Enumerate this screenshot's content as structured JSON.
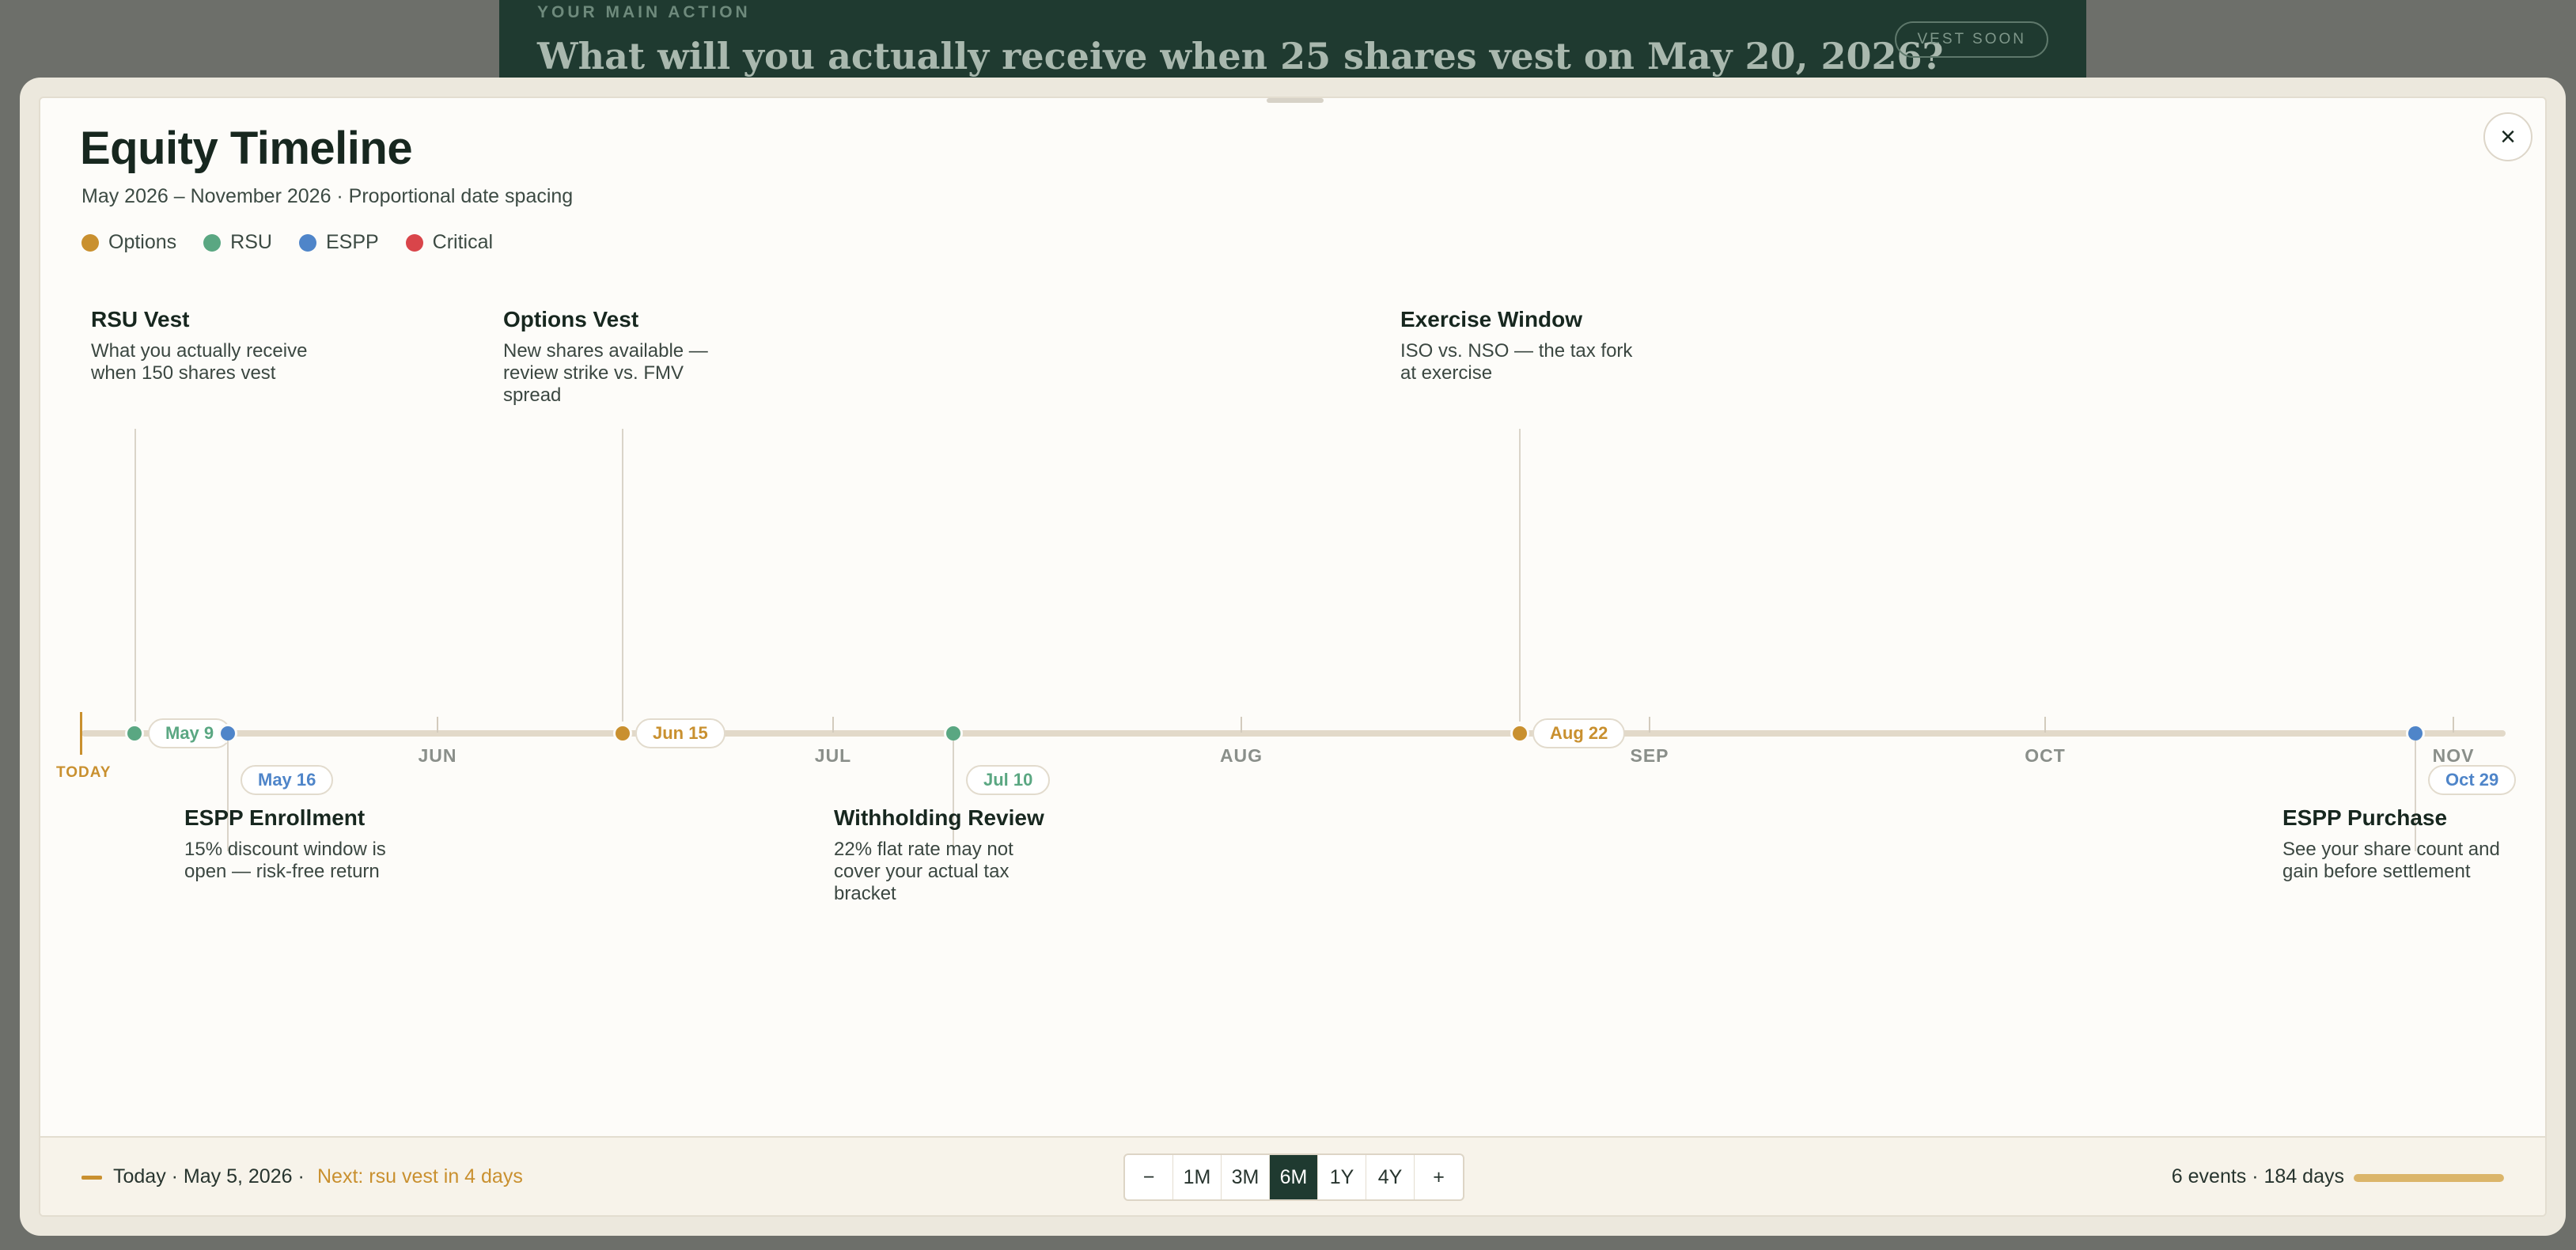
{
  "background": {
    "eyebrow": "YOUR MAIN ACTION",
    "heading": "What will you actually receive when 25 shares vest on May 20, 2026?",
    "badge": "VEST SOON"
  },
  "modal": {
    "title": "Equity Timeline",
    "subtitle": "May 2026 – November 2026 · Proportional date spacing",
    "close_icon": "×"
  },
  "legend": [
    {
      "label": "Options",
      "color": "#c9902f"
    },
    {
      "label": "RSU",
      "color": "#5aa782"
    },
    {
      "label": "ESPP",
      "color": "#4f85c9"
    },
    {
      "label": "Critical",
      "color": "#d9454a"
    }
  ],
  "timeline": {
    "today_label": "TODAY",
    "months": [
      "JUN",
      "JUL",
      "AUG",
      "SEP",
      "OCT",
      "NOV"
    ],
    "events": [
      {
        "date": "May 9",
        "title": "RSU Vest",
        "desc": "What you actually receive when 150 shares vest",
        "type": "RSU",
        "color": "#5aa782"
      },
      {
        "date": "May 16",
        "title": "ESPP Enrollment",
        "desc": "15% discount window is open — risk-free return",
        "type": "ESPP",
        "color": "#4f85c9"
      },
      {
        "date": "Jun 15",
        "title": "Options Vest",
        "desc": "New shares available — review strike vs. FMV spread",
        "type": "Options",
        "color": "#c9902f"
      },
      {
        "date": "Jul 10",
        "title": "Withholding Review",
        "desc": "22% flat rate may not cover your actual tax bracket",
        "type": "RSU",
        "color": "#5aa782"
      },
      {
        "date": "Aug 22",
        "title": "Exercise Window",
        "desc": "ISO vs. NSO — the tax fork at exercise",
        "type": "Options",
        "color": "#c9902f"
      },
      {
        "date": "Oct 29",
        "title": "ESPP Purchase",
        "desc": "See your share count and gain before settlement",
        "type": "ESPP",
        "color": "#4f85c9"
      }
    ]
  },
  "footer": {
    "today": "Today · May 5, 2026 ·",
    "next": "Next: rsu vest in 4 days",
    "zoom": [
      "−",
      "1M",
      "3M",
      "6M",
      "1Y",
      "4Y",
      "+"
    ],
    "zoom_active": "6M",
    "stats": "6 events · 184 days",
    "progress": 1.0
  }
}
